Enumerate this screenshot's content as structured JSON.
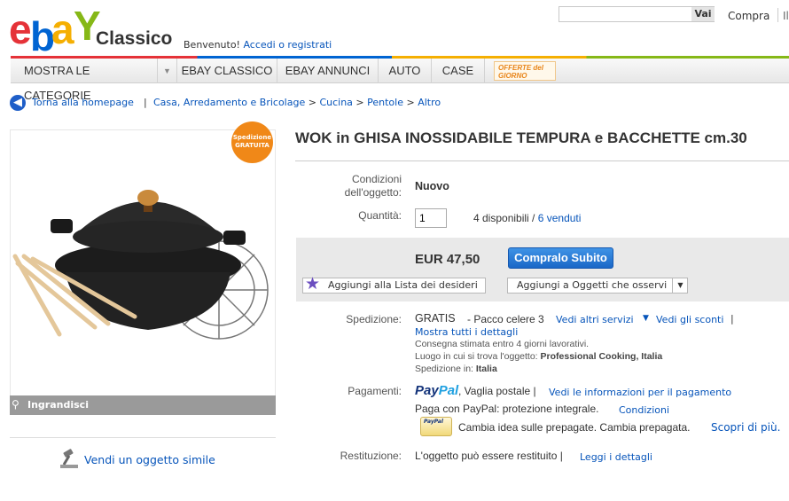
{
  "header": {
    "logo_letters": [
      "e",
      "b",
      "a",
      "Y"
    ],
    "logo_colors": [
      "#e53238",
      "#0064d2",
      "#f5af02",
      "#86b817"
    ],
    "brand_suffix": "Classico",
    "welcome": "Benvenuto!",
    "login_link": "Accedi o registrati",
    "search_value": "",
    "search_button": "Vai",
    "compra": "Compra",
    "more": "Il"
  },
  "nav": {
    "items": [
      "MOSTRA LE CATEGORIE",
      "EBAY CLASSICO",
      "EBAY ANNUNCI",
      "AUTO",
      "CASE"
    ],
    "offerte": "OFFERTE del GIORNO"
  },
  "breadcrumb": {
    "back": "Torna alla homepage",
    "separator": "|",
    "path": [
      "Casa, Arredamento e Bricolage",
      "Cucina",
      "Pentole",
      "Altro"
    ],
    "arrow": ">"
  },
  "image": {
    "badge_line1": "Spedizione",
    "badge_line2": "GRATUITA",
    "zoom": "Ingrandisci"
  },
  "sell_similar": "Vendi un oggetto simile",
  "item": {
    "title": "WOK in GHISA INOSSIDABILE TEMPURA e BACCHETTE cm.30",
    "condition_label_1": "Condizioni",
    "condition_label_2": "dell'oggetto:",
    "condition": "Nuovo",
    "quantity_label": "Quantità:",
    "quantity_value": "1",
    "available": "4 disponibili /",
    "sold": "6 venduti",
    "price": "EUR 47,50",
    "buy_button": "Compralo Subito",
    "wishlist": "Aggiungi alla Lista dei desideri",
    "watch": "Aggiungi a Oggetti che osservi"
  },
  "shipping": {
    "label": "Spedizione:",
    "cost": "GRATIS",
    "service": "- Pacco celere 3",
    "other_services": "Vedi altri servizi",
    "discounts": "Vedi gli sconti",
    "sep": "|",
    "show_all": "Mostra tutti i dettagli",
    "delivery": "Consegna stimata entro 4 giorni lavorativi.",
    "location_label": "Luogo in cui si trova l'oggetto:",
    "location": "Professional Cooking, Italia",
    "ships_to_label": "Spedizione in:",
    "ships_to": "Italia"
  },
  "payments": {
    "label": "Pagamenti:",
    "paypal_a": "Pay",
    "paypal_b": "Pal",
    "methods": ", Vaglia postale |",
    "info_link": "Vedi le informazioni per il pagamento",
    "protection": "Paga con PayPal: protezione integrale.",
    "conditions": "Condizioni",
    "prepaid": "Cambia idea sulle prepagate. Cambia prepagata.",
    "learn_more": "Scopri di più.",
    "card_text": "PayPal"
  },
  "returns": {
    "label": "Restituzione:",
    "text": "L'oggetto può essere restituito |",
    "details": "Leggi i dettagli"
  }
}
